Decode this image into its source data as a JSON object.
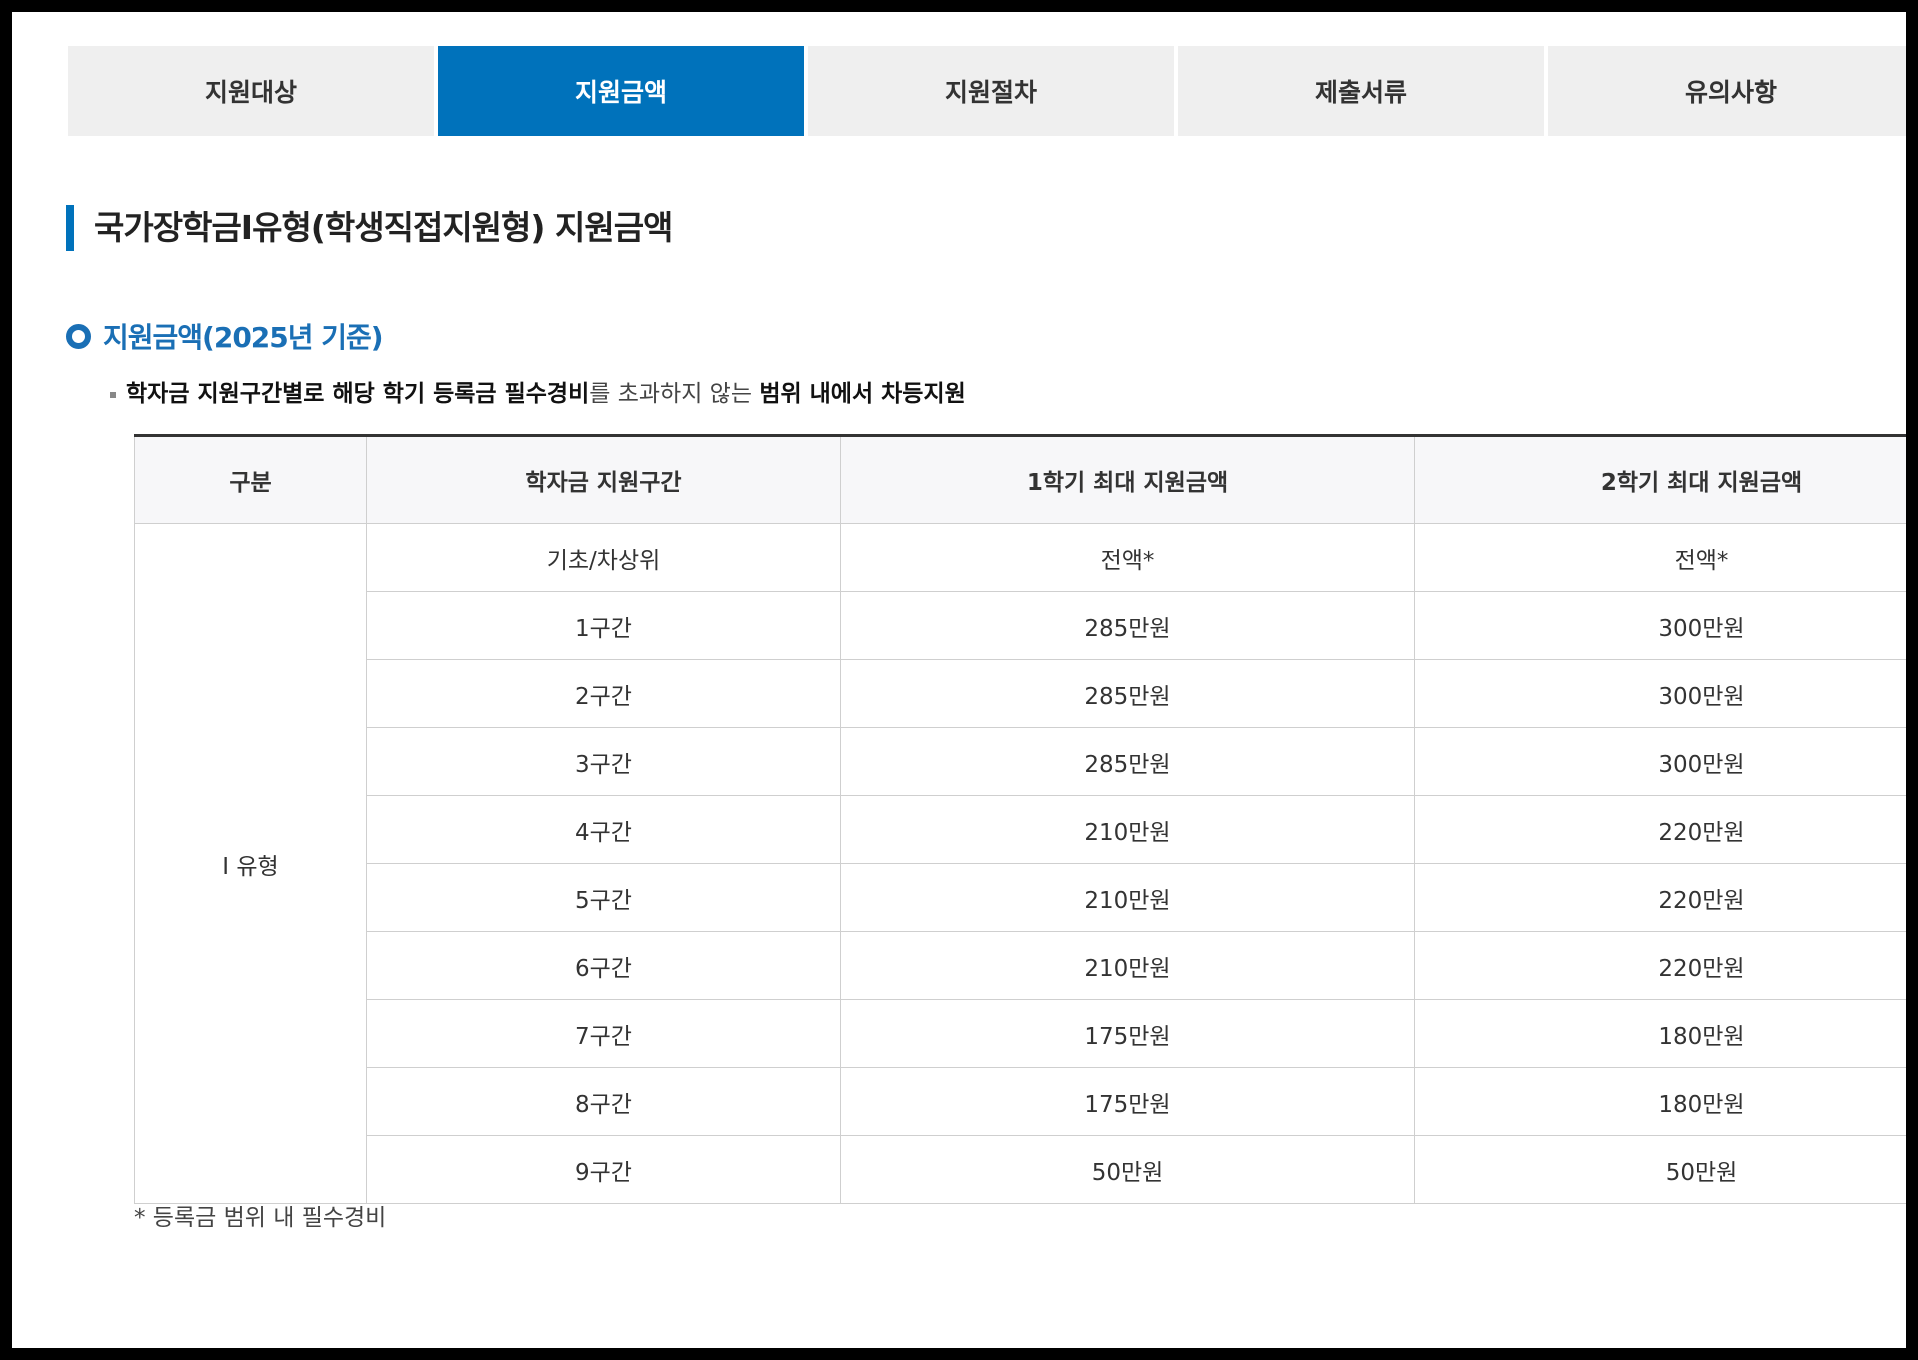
{
  "tabs": [
    {
      "label": "지원대상",
      "active": false
    },
    {
      "label": "지원금액",
      "active": true
    },
    {
      "label": "지원절차",
      "active": false
    },
    {
      "label": "제출서류",
      "active": false
    },
    {
      "label": "유의사항",
      "active": false
    }
  ],
  "page_title": "국가장학금Ⅰ유형(학생직접지원형) 지원금액",
  "section_title": "지원금액(2025년 기준)",
  "description": {
    "part1": "학자금 지원구간별로 해당 학기 등록금 필수경비",
    "part2": "를 초과하지 않는 ",
    "part3": "범위 내에서 차등지원"
  },
  "table": {
    "headers": [
      "구분",
      "학자금 지원구간",
      "1학기 최대 지원금액",
      "2학기 최대 지원금액"
    ],
    "group_label": "Ⅰ 유형",
    "rows": [
      [
        "기초/차상위",
        "전액*",
        "전액*"
      ],
      [
        "1구간",
        "285만원",
        "300만원"
      ],
      [
        "2구간",
        "285만원",
        "300만원"
      ],
      [
        "3구간",
        "285만원",
        "300만원"
      ],
      [
        "4구간",
        "210만원",
        "220만원"
      ],
      [
        "5구간",
        "210만원",
        "220만원"
      ],
      [
        "6구간",
        "210만원",
        "220만원"
      ],
      [
        "7구간",
        "175만원",
        "180만원"
      ],
      [
        "8구간",
        "175만원",
        "180만원"
      ],
      [
        "9구간",
        "50만원",
        "50만원"
      ]
    ]
  },
  "footnote": "* 등록금 범위 내 필수경비",
  "colors": {
    "accent": "#0072bb",
    "section": "#1a6fb5"
  }
}
